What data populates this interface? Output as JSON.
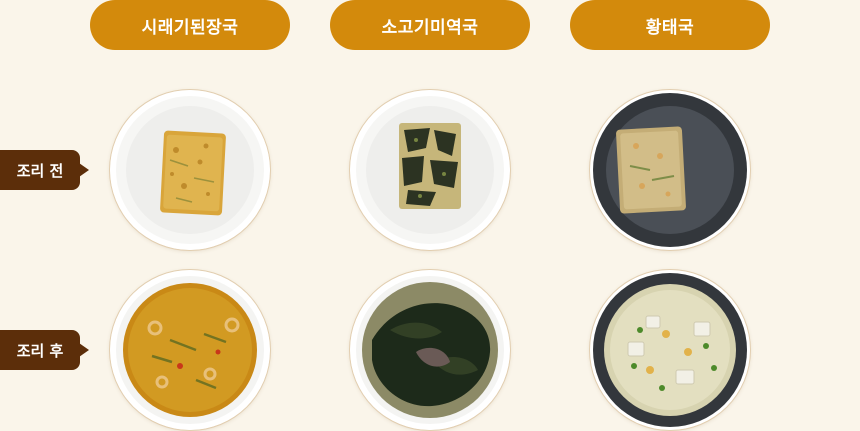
{
  "columns": [
    {
      "label": "시래기된장국",
      "icon": "dried-radish-greens-soy-soup-image"
    },
    {
      "label": "소고기미역국",
      "icon": "beef-seaweed-soup-image"
    },
    {
      "label": "황태국",
      "icon": "dried-pollack-soup-image"
    }
  ],
  "rows": [
    {
      "label": "조리 전"
    },
    {
      "label": "조리 후"
    }
  ],
  "colors": {
    "background": "#faf5ea",
    "pill": "#d38a0c",
    "row_label": "#5c2e0a",
    "plate_white": "#ffffff",
    "plate_dark": "#3c4046"
  }
}
